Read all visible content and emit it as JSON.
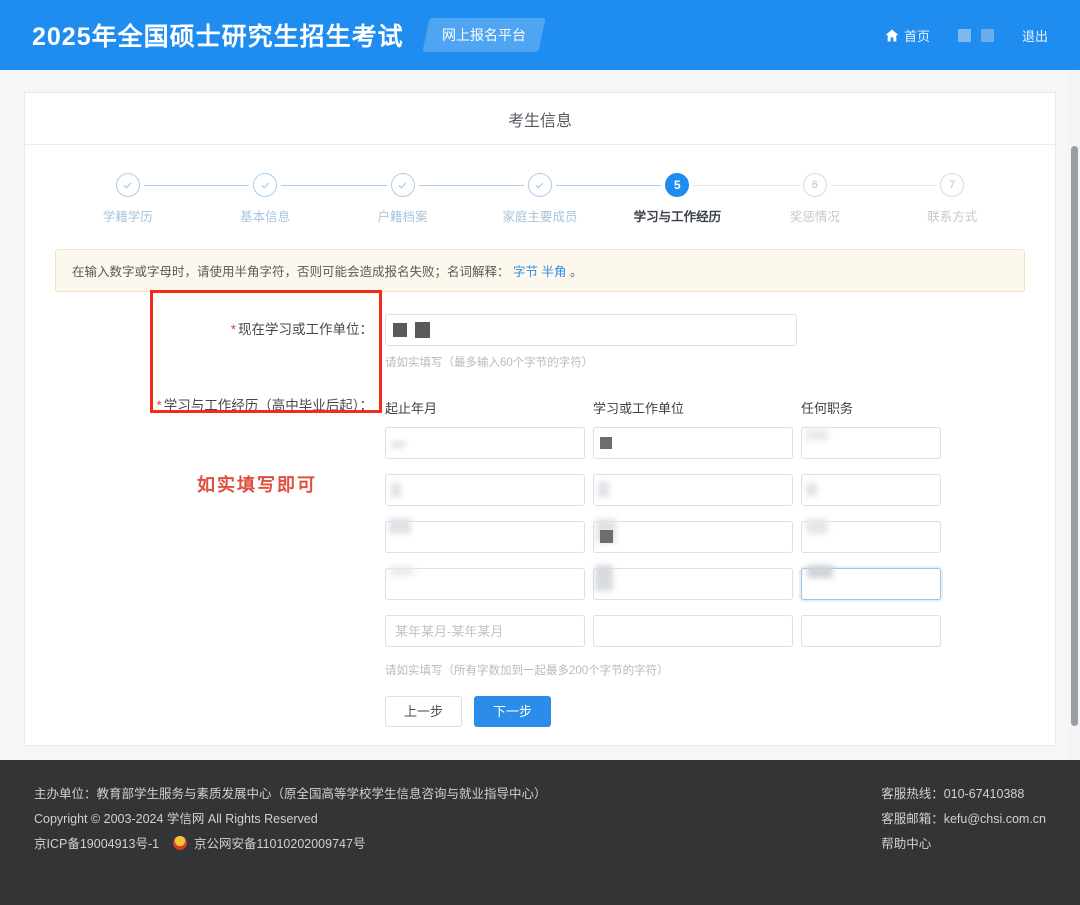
{
  "header": {
    "title": "2025年全国硕士研究生招生考试",
    "badge": "网上报名平台",
    "home_label": "首页",
    "logout_label": "退出"
  },
  "card": {
    "title": "考生信息"
  },
  "stepper": {
    "steps": [
      {
        "num": "1",
        "label": "学籍学历",
        "state": "done"
      },
      {
        "num": "2",
        "label": "基本信息",
        "state": "done"
      },
      {
        "num": "3",
        "label": "户籍档案",
        "state": "done"
      },
      {
        "num": "4",
        "label": "家庭主要成员",
        "state": "done"
      },
      {
        "num": "5",
        "label": "学习与工作经历",
        "state": "current"
      },
      {
        "num": "6",
        "label": "奖惩情况",
        "state": "todo"
      },
      {
        "num": "7",
        "label": "联系方式",
        "state": "todo"
      }
    ]
  },
  "notice": {
    "text_before": "在输入数字或字母时，请使用半角字符，否则可能会造成报名失败；名词解释：",
    "link_1": "字节",
    "link_2": "半角",
    "text_after": "。"
  },
  "form": {
    "current_unit": {
      "label": "现在学习或工作单位：",
      "required": true,
      "value": "",
      "placeholder": "",
      "hint": "请如实填写（最多输入60个字节的字符）"
    },
    "experience": {
      "label": "学习与工作经历（高中毕业后起）：",
      "required": true,
      "columns": [
        "起止年月",
        "学习或工作单位",
        "任何职务"
      ],
      "rows": [
        {
          "period": "",
          "unit": "",
          "post": "",
          "period_placeholder": "",
          "unit_placeholder": "",
          "post_placeholder": ""
        },
        {
          "period": "",
          "unit": "",
          "post": "",
          "period_placeholder": "",
          "unit_placeholder": "",
          "post_placeholder": ""
        },
        {
          "period": "",
          "unit": "",
          "post": "",
          "period_placeholder": "",
          "unit_placeholder": "",
          "post_placeholder": ""
        },
        {
          "period": "",
          "unit": "",
          "post": "",
          "period_placeholder": "",
          "unit_placeholder": "",
          "post_placeholder": ""
        },
        {
          "period": "",
          "unit": "",
          "post": "",
          "period_placeholder": "某年某月-某年某月",
          "unit_placeholder": "",
          "post_placeholder": ""
        }
      ],
      "hint": "请如实填写（所有字数加到一起最多200个字节的字符）"
    },
    "buttons": {
      "prev": "上一步",
      "next": "下一步"
    }
  },
  "annotations": {
    "note_text": "如实填写即可",
    "box_color": "#f32b1b",
    "text_color": "#e0503f"
  },
  "footer": {
    "organizer": "主办单位：教育部学生服务与素质发展中心（原全国高等学校学生信息咨询与就业指导中心）",
    "copyright": "Copyright © 2003-2024 学信网 All Rights Reserved",
    "icp": "京ICP备19004913号-1",
    "police": "京公网安备11010202009747号",
    "hotline": "客服热线：010-67410388",
    "email": "客服邮箱：kefu@chsi.com.cn",
    "help": "帮助中心"
  }
}
